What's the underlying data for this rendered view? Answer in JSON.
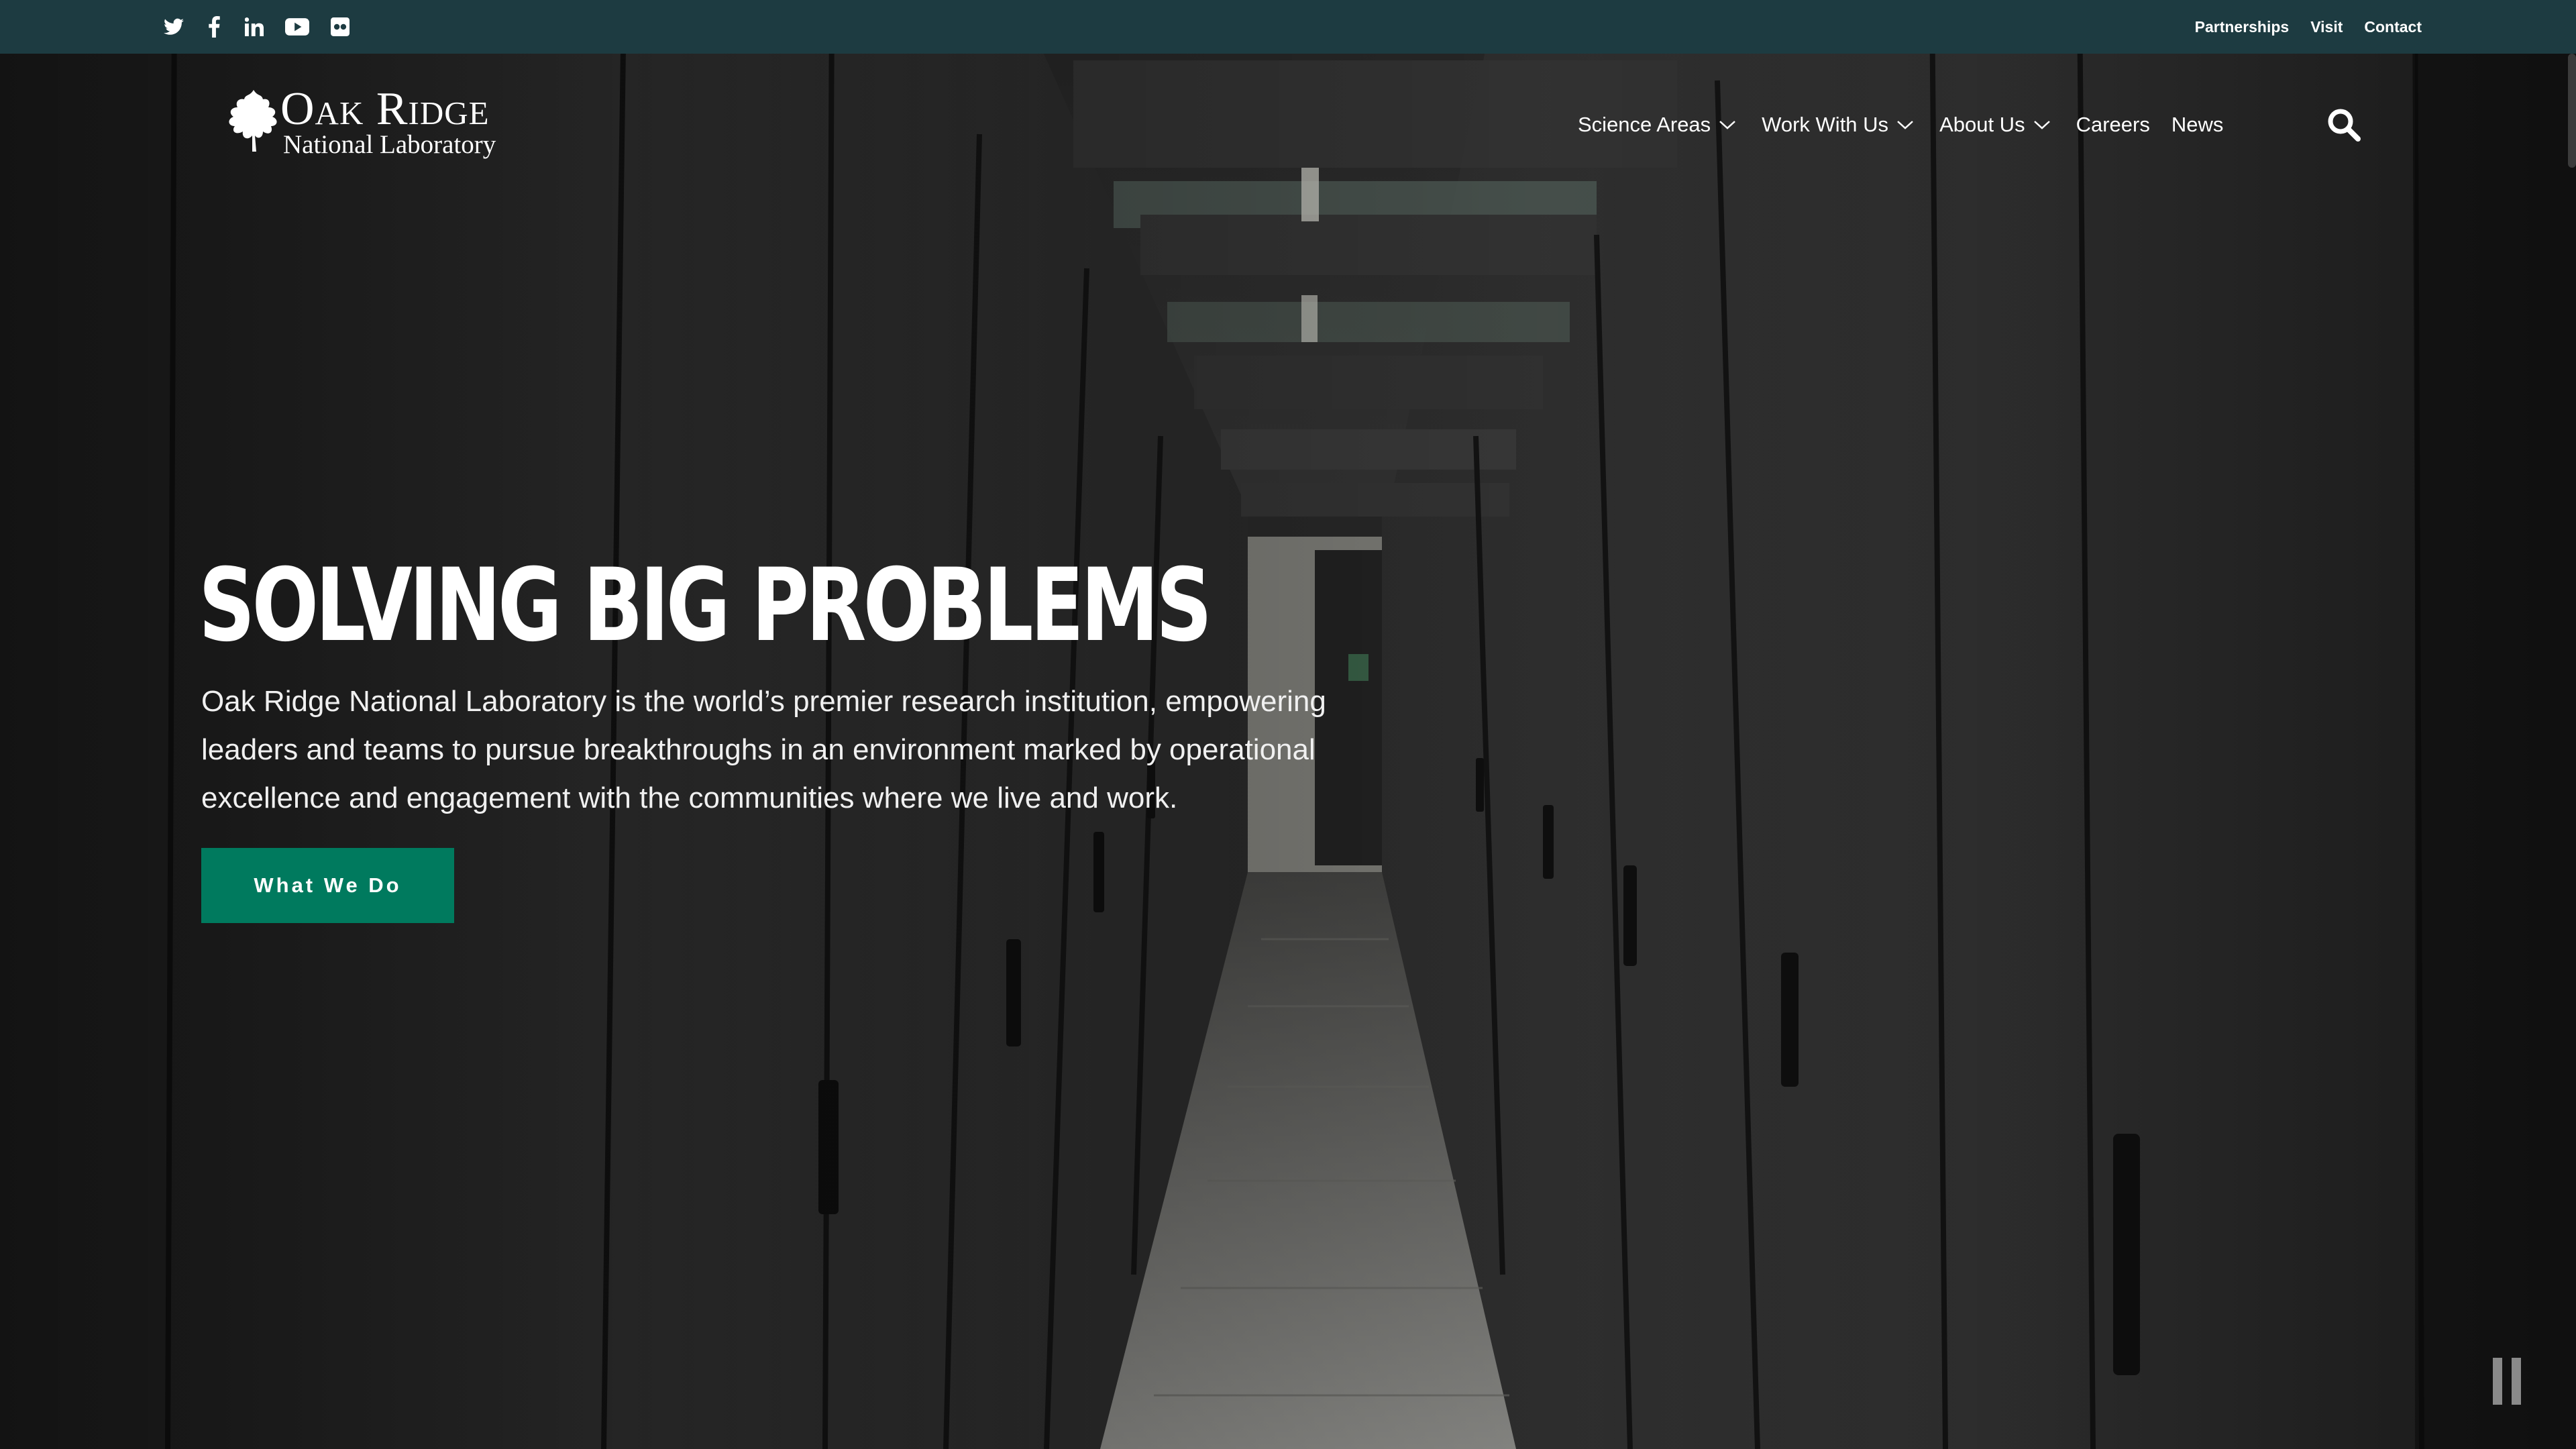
{
  "social": {
    "items": [
      {
        "name": "twitter-icon"
      },
      {
        "name": "facebook-icon"
      },
      {
        "name": "linkedin-icon"
      },
      {
        "name": "youtube-icon"
      },
      {
        "name": "flickr-icon"
      }
    ]
  },
  "utility": {
    "partnerships": "Partnerships",
    "visit": "Visit",
    "contact": "Contact"
  },
  "logo": {
    "line1": "Oak Ridge",
    "line2": "National Laboratory"
  },
  "nav": {
    "science_areas": "Science Areas",
    "work_with_us": "Work With Us",
    "about_us": "About Us",
    "careers": "Careers",
    "news": "News"
  },
  "hero": {
    "title": "SOLVING BIG PROBLEMS",
    "description": "Oak Ridge National Laboratory is the world’s premier research institution, empowering leaders and teams to pursue breakthroughs in an environment marked by operational excellence and engagement with the communities where we live and work.",
    "cta_label": "What We Do"
  },
  "colors": {
    "utility_bar": "#1d3b41",
    "cta": "#007a5e",
    "text": "#ffffff"
  }
}
